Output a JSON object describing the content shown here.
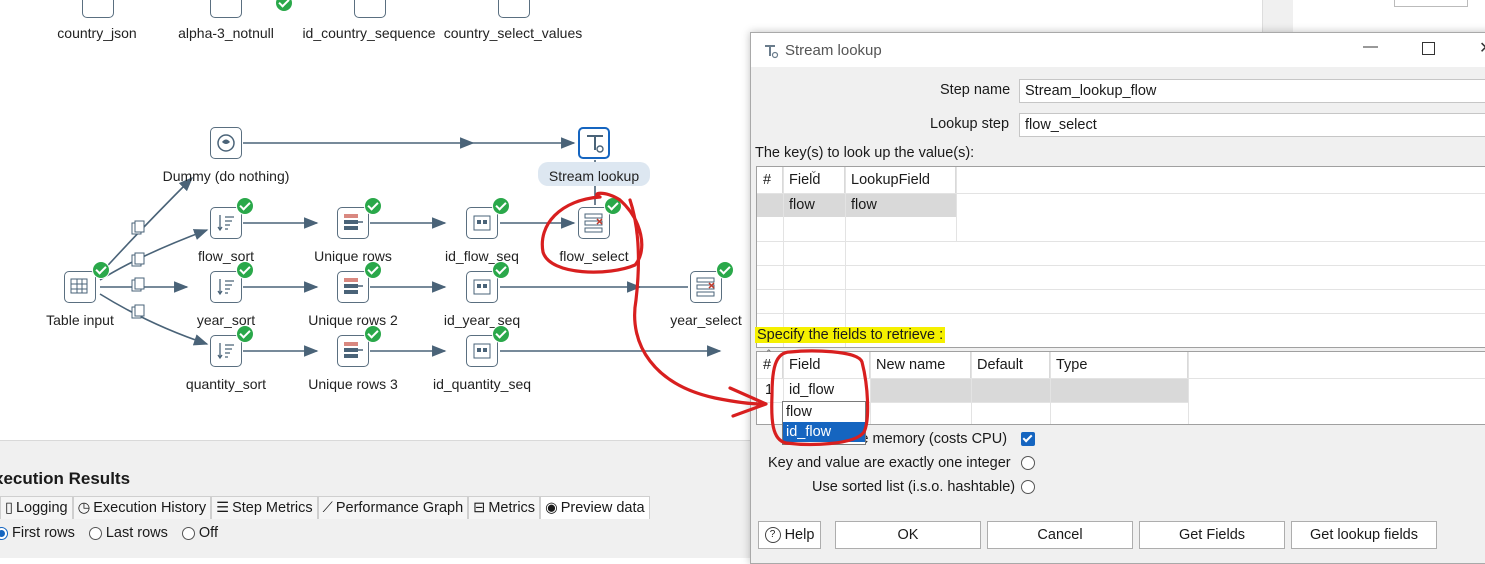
{
  "canvas": {
    "top_steps": [
      "country_json",
      "alpha-3_notnull",
      "id_country_sequence",
      "country_select_values"
    ],
    "steps": {
      "dummy": "Dummy (do nothing)",
      "stream_lookup": "Stream lookup",
      "flow_sort": "flow_sort",
      "unique_rows": "Unique rows",
      "id_flow_seq": "id_flow_seq",
      "flow_select": "flow_select",
      "table_input": "Table input",
      "year_sort": "year_sort",
      "unique_rows_2": "Unique rows 2",
      "id_year_seq": "id_year_seq",
      "year_select": "year_select",
      "quantity_sort": "quantity_sort",
      "unique_rows_3": "Unique rows 3",
      "id_quantity_seq": "id_quantity_seq"
    }
  },
  "results": {
    "title": "xecution Results",
    "tabs": [
      "Logging",
      "Execution History",
      "Step Metrics",
      "Performance Graph",
      "Metrics",
      "Preview data"
    ],
    "radios": [
      {
        "label": "First rows",
        "selected": true
      },
      {
        "label": "Last rows",
        "selected": false
      },
      {
        "label": "Off",
        "selected": false
      }
    ]
  },
  "dialog": {
    "title": "Stream lookup",
    "step_name_label": "Step name",
    "step_name_value": "Stream_lookup_flow",
    "lookup_step_label": "Lookup step",
    "lookup_step_value": "flow_select",
    "keys_label": "The key(s) to look up the value(s):",
    "keys_table": {
      "headers": [
        "#",
        "Field",
        "LookupField"
      ],
      "rows": [
        {
          "field": "flow",
          "lookup": "flow"
        }
      ]
    },
    "retrieve_label": "Specify the fields to retrieve :",
    "retrieve_table": {
      "headers": [
        "#",
        "Field",
        "New name",
        "Default",
        "Type"
      ],
      "rows": [
        {
          "num": "1",
          "field": "id_flow"
        }
      ]
    },
    "dropdown_options": [
      "flow",
      "id_flow"
    ],
    "dropdown_selected": "id_flow",
    "checkboxes": [
      {
        "label": "Preserve memory (costs CPU)",
        "visible_label": "serve memory (costs CPU)",
        "checked": true
      },
      {
        "label": "Key and value are exactly one integer",
        "checked": false
      },
      {
        "label": "Use sorted list (i.s.o. hashtable)",
        "checked": false
      }
    ],
    "buttons": [
      "Help",
      "OK",
      "Cancel",
      "Get Fields",
      "Get lookup fields"
    ]
  },
  "colors": {
    "accent": "#1565c0",
    "annotation": "#d81f1f",
    "highlight": "#f5f000",
    "check": "#2aa84a"
  }
}
